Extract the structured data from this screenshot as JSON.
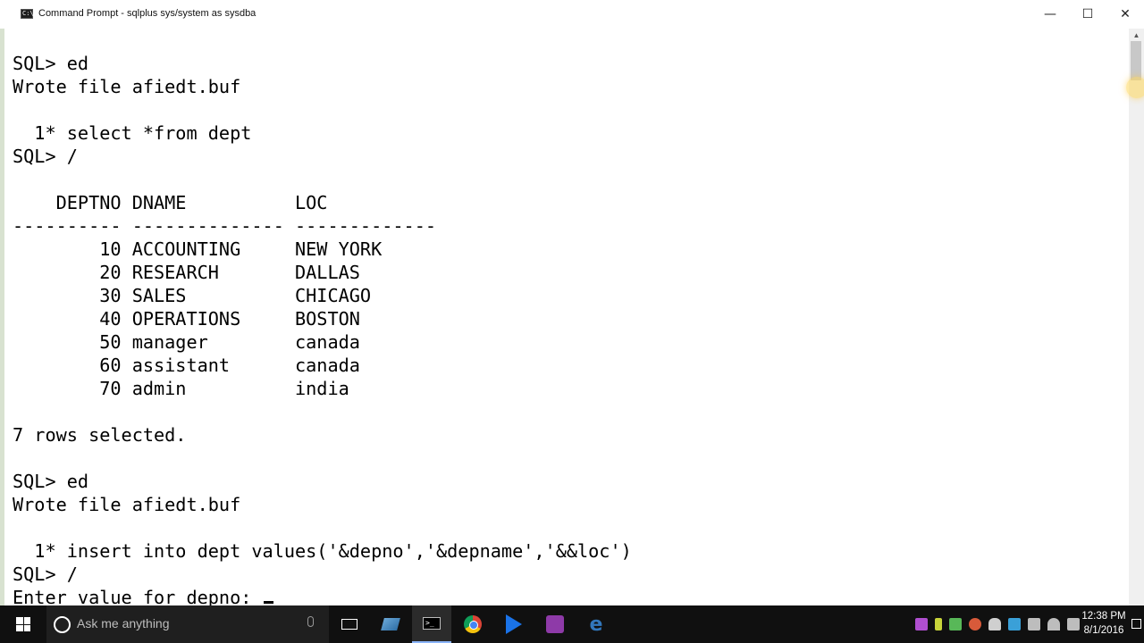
{
  "window": {
    "title": "Command Prompt - sqlplus  sys/system as sysdba",
    "minimize": "—",
    "maximize": "☐",
    "close": "✕"
  },
  "console": {
    "lines": [
      "SQL> ed",
      "Wrote file afiedt.buf",
      "",
      "  1* select *from dept",
      "SQL> /",
      "",
      "    DEPTNO DNAME          LOC",
      "---------- -------------- -------------",
      "        10 ACCOUNTING     NEW YORK",
      "        20 RESEARCH       DALLAS",
      "        30 SALES          CHICAGO",
      "        40 OPERATIONS     BOSTON",
      "        50 manager        canada",
      "        60 assistant      canada",
      "        70 admin          india",
      "",
      "7 rows selected.",
      "",
      "SQL> ed",
      "Wrote file afiedt.buf",
      "",
      "  1* insert into dept values('&depno','&depname','&&loc')",
      "SQL> /",
      "Enter value for depno: "
    ]
  },
  "taskbar": {
    "search_placeholder": "Ask me anything",
    "time": "12:38 PM",
    "date": "8/1/2016",
    "icons": [
      "windows-icon",
      "cortana-icon",
      "microphone-icon",
      "task-view-icon",
      "file-explorer-icon",
      "command-prompt-icon",
      "chrome-icon",
      "media-player-icon",
      "video-app-icon",
      "edge-icon"
    ]
  },
  "colors": {
    "taskbar": "#101010",
    "console_bg": "#ffffff",
    "console_text": "#000000"
  }
}
